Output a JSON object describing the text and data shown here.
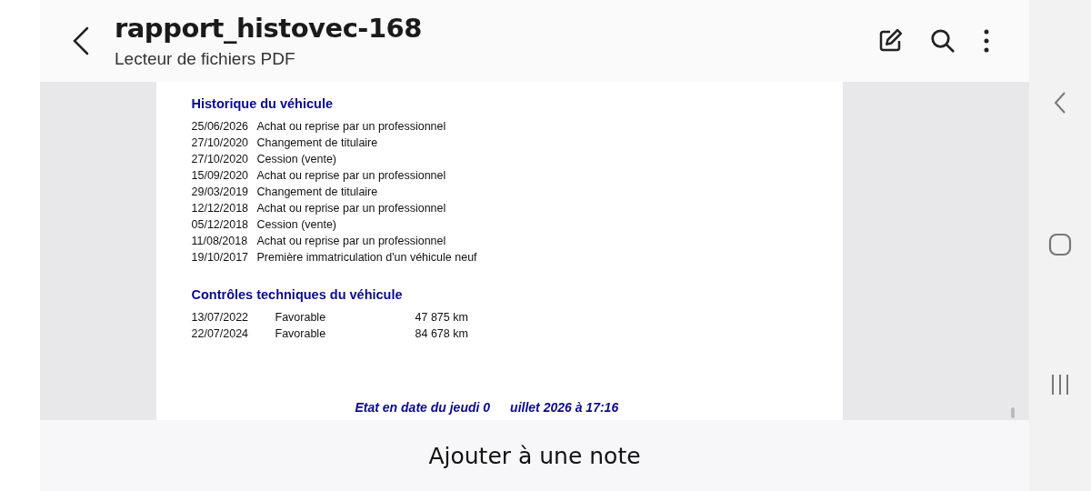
{
  "header": {
    "title": "rapport_histovec-168",
    "subtitle": "Lecteur de fichiers PDF"
  },
  "document": {
    "history": {
      "heading": "Historique du véhicule",
      "rows": [
        {
          "date": "25/06/2026",
          "event": "Achat ou reprise par un professionnel"
        },
        {
          "date": "27/10/2020",
          "event": "Changement de titulaire"
        },
        {
          "date": "27/10/2020",
          "event": "Cession (vente)"
        },
        {
          "date": "15/09/2020",
          "event": "Achat ou reprise par un professionnel"
        },
        {
          "date": "29/03/2019",
          "event": "Changement de titulaire"
        },
        {
          "date": "12/12/2018",
          "event": "Achat ou reprise par un professionnel"
        },
        {
          "date": "05/12/2018",
          "event": "Cession (vente)"
        },
        {
          "date": "11/08/2018",
          "event": "Achat ou reprise par un professionnel"
        },
        {
          "date": "19/10/2017",
          "event": "Première immatriculation d'un véhicule neuf"
        }
      ]
    },
    "inspections": {
      "heading": "Contrôles techniques du véhicule",
      "rows": [
        {
          "date": "13/07/2022",
          "result": "Favorable",
          "mileage": "47 875 km"
        },
        {
          "date": "22/07/2024",
          "result": "Favorable",
          "mileage": "84 678 km"
        }
      ]
    },
    "footer_parts": [
      "Etat en date du jeudi 0",
      "uillet 2026 à 17:16"
    ]
  },
  "note_button": "Ajouter à une note"
}
